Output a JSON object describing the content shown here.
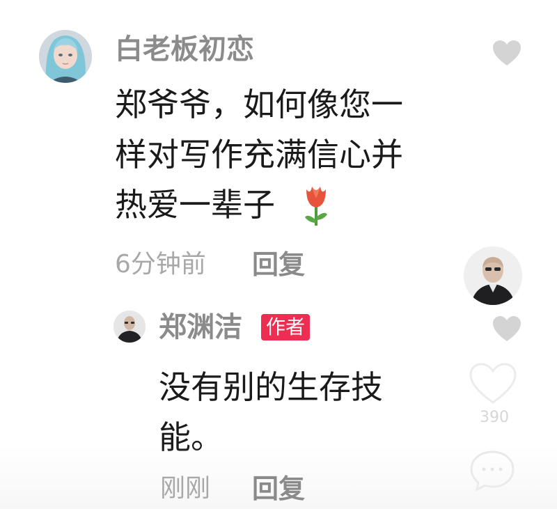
{
  "comments": [
    {
      "username": "白老板初恋",
      "text": "郑爷爷，如何像您一\n样对写作充满信心并\n热爱一辈子",
      "emoji": "tulip-emoji",
      "time": "6分钟前",
      "reply_label": "回复"
    }
  ],
  "reply": {
    "username": "郑渊洁",
    "badge": "作者",
    "text": "没有别的生存技\n能。",
    "time": "刚刚",
    "reply_label": "回复"
  },
  "sidebar": {
    "like_count": "390"
  },
  "colors": {
    "badge_bg": "#ee2d52",
    "username": "#8b8b8b",
    "body_text": "#1a1a1a",
    "meta": "#a8a8a8",
    "heart": "#d4d4d4"
  }
}
